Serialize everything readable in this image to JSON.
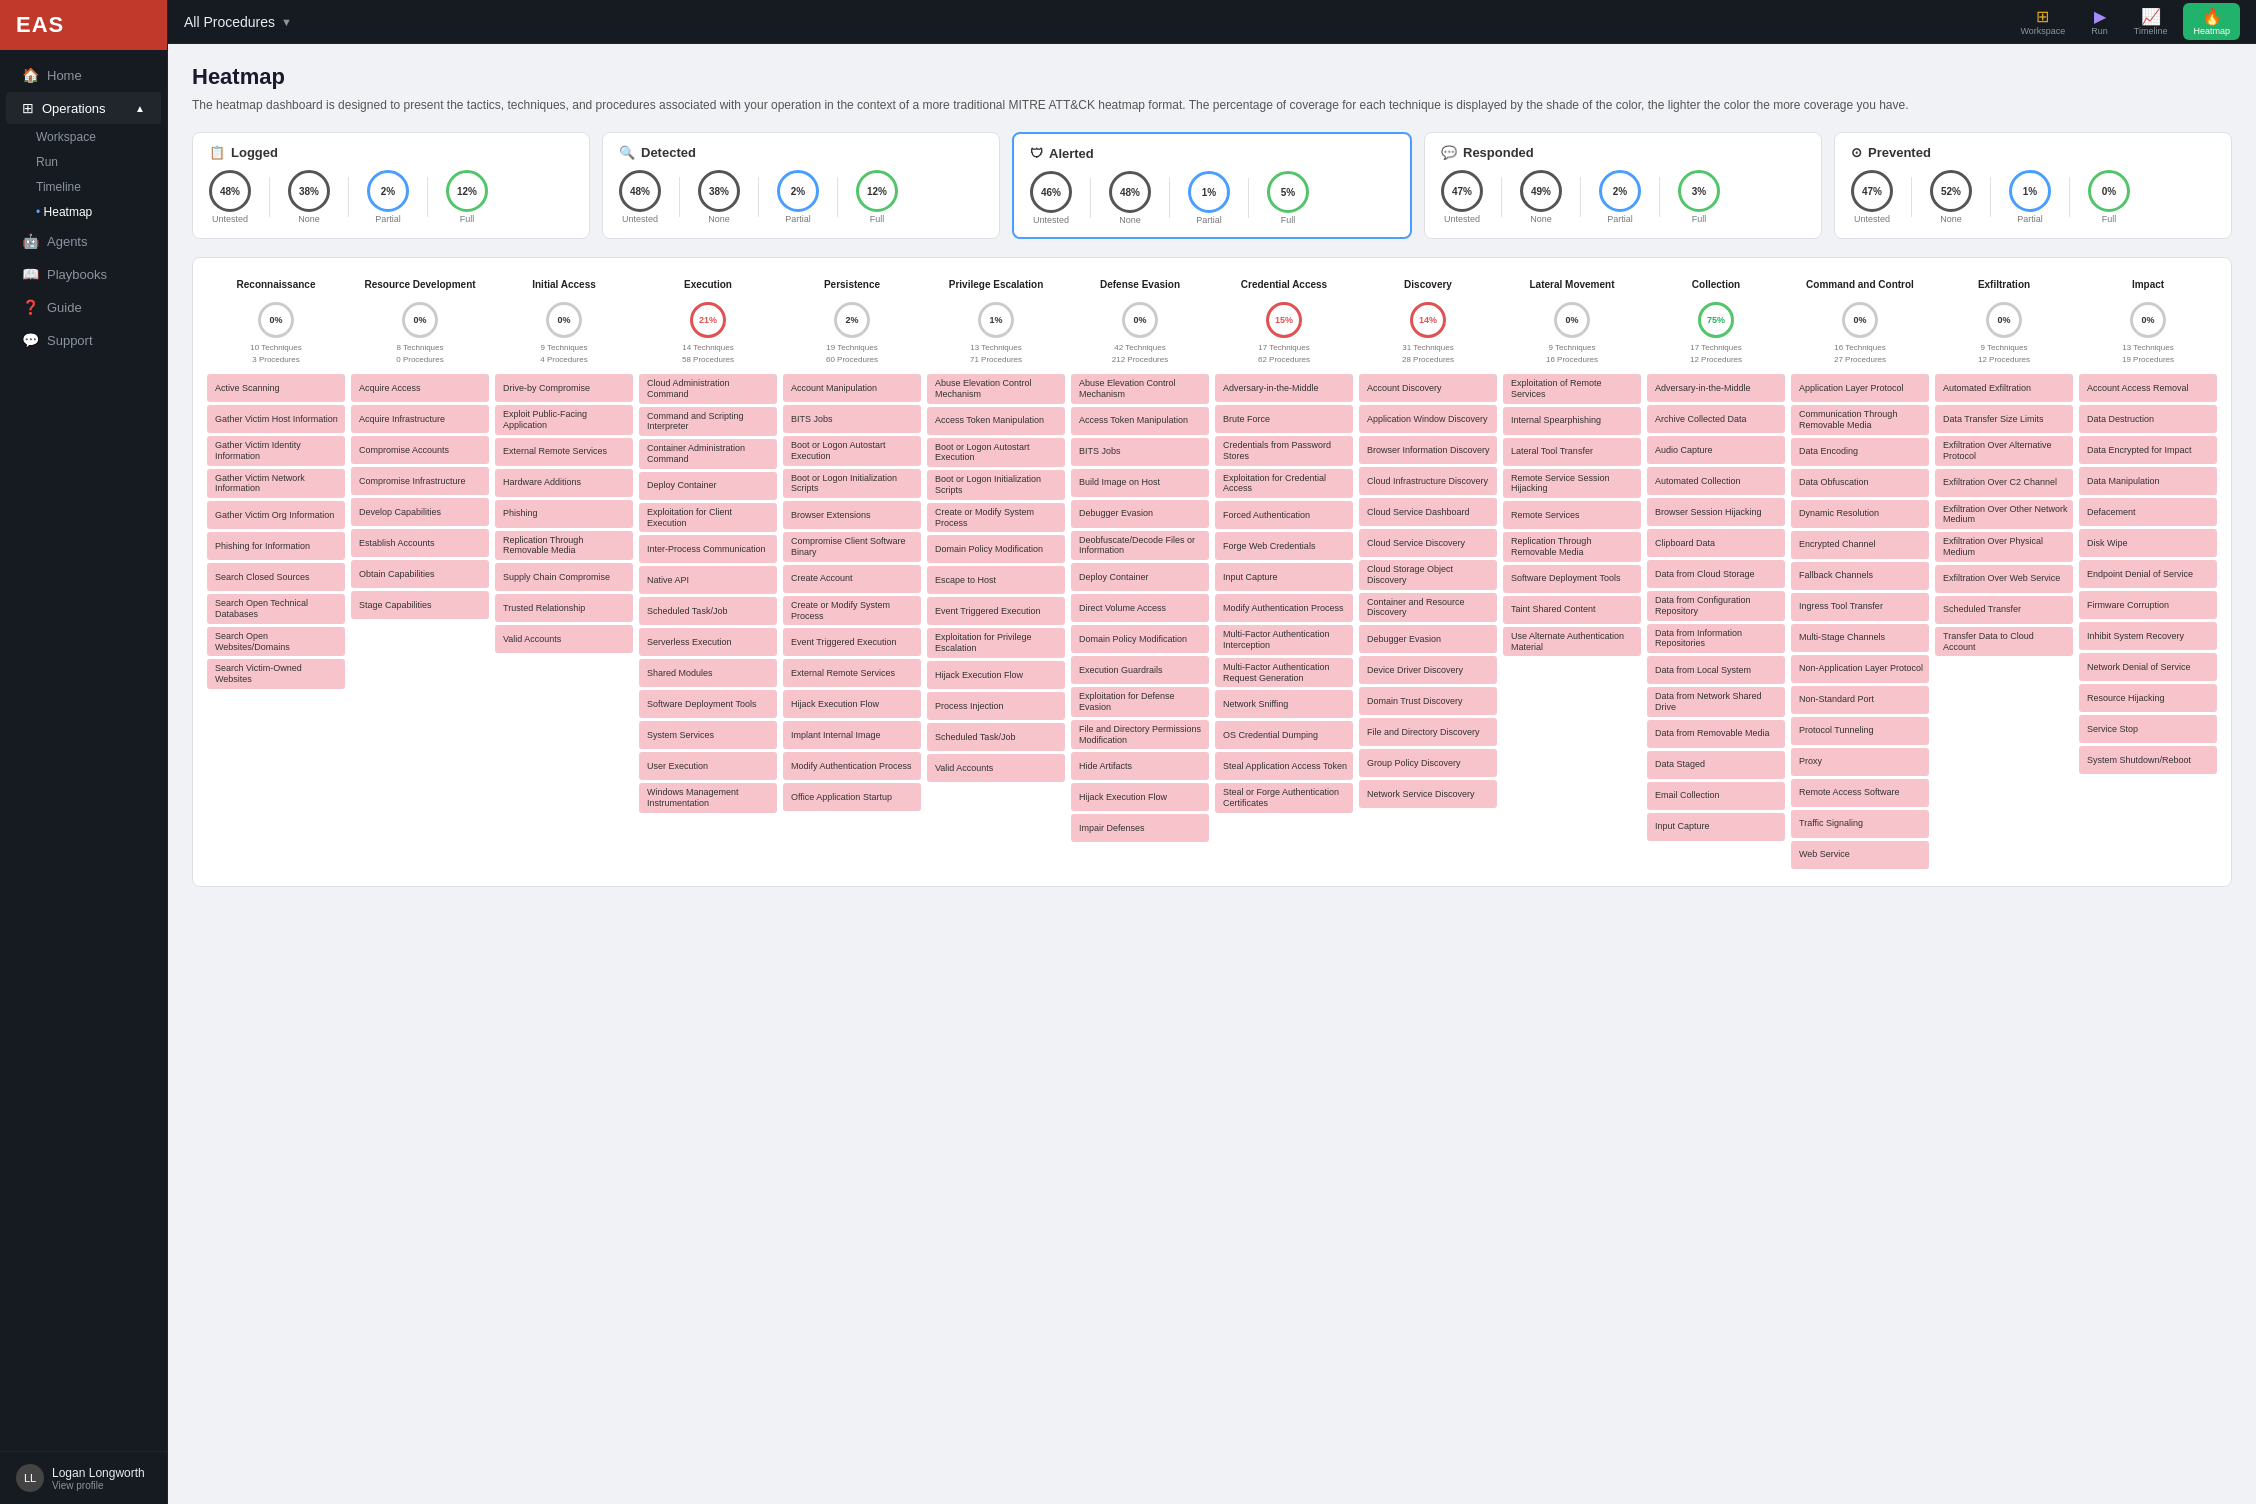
{
  "app": {
    "logo": "EAS",
    "procedure_selector": "All Procedures",
    "topbar_buttons": [
      {
        "id": "workspace",
        "label": "Workspace",
        "icon": "⊞"
      },
      {
        "id": "run",
        "label": "Run",
        "icon": "▶"
      },
      {
        "id": "timeline",
        "label": "Timeline",
        "icon": "📈"
      },
      {
        "id": "heatmap",
        "label": "Heatmap",
        "icon": "🔥",
        "active": true
      }
    ]
  },
  "sidebar": {
    "nav_items": [
      {
        "id": "home",
        "label": "Home",
        "icon": "🏠"
      },
      {
        "id": "operations",
        "label": "Operations",
        "icon": "⚙",
        "active": true,
        "expanded": true
      },
      {
        "id": "agents",
        "label": "Agents",
        "icon": "🤖"
      },
      {
        "id": "playbooks",
        "label": "Playbooks",
        "icon": "📖"
      },
      {
        "id": "guide",
        "label": "Guide",
        "icon": "❓"
      },
      {
        "id": "support",
        "label": "Support",
        "icon": "💬"
      }
    ],
    "sub_items": [
      {
        "id": "workspace",
        "label": "Workspace"
      },
      {
        "id": "run",
        "label": "Run"
      },
      {
        "id": "timeline",
        "label": "Timeline"
      },
      {
        "id": "heatmap",
        "label": "Heatmap",
        "active": true
      }
    ],
    "user": {
      "name": "Logan Longworth",
      "sub": "View profile"
    }
  },
  "page": {
    "title": "Heatmap",
    "description": "The heatmap dashboard is designed to present the tactics, techniques, and procedures associated with your operation in the context of a more traditional MITRE ATT&CK heatmap format. The percentage of coverage for each technique is displayed by the shade of the color, the lighter the color the more coverage you have."
  },
  "summary_cards": [
    {
      "id": "logged",
      "title": "Logged",
      "icon": "📋",
      "metrics": [
        {
          "label": "Untested",
          "value": "48%",
          "ring": "dark"
        },
        {
          "label": "None",
          "value": "38%",
          "ring": "dark"
        },
        {
          "label": "Partial",
          "value": "2%",
          "ring": "blue"
        },
        {
          "label": "Full",
          "value": "12%",
          "ring": "green"
        }
      ]
    },
    {
      "id": "detected",
      "title": "Detected",
      "icon": "🔍",
      "metrics": [
        {
          "label": "Untested",
          "value": "48%",
          "ring": "dark"
        },
        {
          "label": "None",
          "value": "38%",
          "ring": "dark"
        },
        {
          "label": "Partial",
          "value": "2%",
          "ring": "blue"
        },
        {
          "label": "Full",
          "value": "12%",
          "ring": "green"
        }
      ]
    },
    {
      "id": "alerted",
      "title": "Alerted",
      "icon": "🛡",
      "highlighted": true,
      "metrics": [
        {
          "label": "Untested",
          "value": "46%",
          "ring": "dark"
        },
        {
          "label": "None",
          "value": "48%",
          "ring": "dark"
        },
        {
          "label": "Partial",
          "value": "1%",
          "ring": "blue"
        },
        {
          "label": "Full",
          "value": "5%",
          "ring": "green"
        }
      ]
    },
    {
      "id": "responded",
      "title": "Responded",
      "icon": "💬",
      "metrics": [
        {
          "label": "Untested",
          "value": "47%",
          "ring": "dark"
        },
        {
          "label": "None",
          "value": "49%",
          "ring": "dark"
        },
        {
          "label": "Partial",
          "value": "2%",
          "ring": "blue"
        },
        {
          "label": "Full",
          "value": "3%",
          "ring": "green"
        }
      ]
    },
    {
      "id": "prevented",
      "title": "Prevented",
      "icon": "⊙",
      "metrics": [
        {
          "label": "Untested",
          "value": "47%",
          "ring": "dark"
        },
        {
          "label": "None",
          "value": "52%",
          "ring": "dark"
        },
        {
          "label": "Partial",
          "value": "1%",
          "ring": "blue"
        },
        {
          "label": "Full",
          "value": "0%",
          "ring": "green"
        }
      ]
    }
  ],
  "heatmap_columns": [
    {
      "id": "reconnaissance",
      "title": "Reconnaissance",
      "percent": "0%",
      "ring": "normal",
      "techniques": 10,
      "procedures": 3,
      "cells": [
        "Active Scanning",
        "Gather Victim Host Information",
        "Gather Victim Identity Information",
        "Gather Victim Network Information",
        "Gather Victim Org Information",
        "Phishing for Information",
        "Search Closed Sources",
        "Search Open Technical Databases",
        "Search Open Websites/Domains",
        "Search Victim-Owned Websites"
      ]
    },
    {
      "id": "resource-development",
      "title": "Resource Development",
      "percent": "0%",
      "ring": "normal",
      "techniques": 8,
      "procedures": 0,
      "cells": [
        "Acquire Access",
        "Acquire Infrastructure",
        "Compromise Accounts",
        "Compromise Infrastructure",
        "Develop Capabilities",
        "Establish Accounts",
        "Obtain Capabilities",
        "Stage Capabilities"
      ]
    },
    {
      "id": "initial-access",
      "title": "Initial Access",
      "percent": "0%",
      "ring": "normal",
      "techniques": 9,
      "procedures": 4,
      "cells": [
        "Drive-by Compromise",
        "Exploit Public-Facing Application",
        "External Remote Services",
        "Hardware Additions",
        "Phishing",
        "Replication Through Removable Media",
        "Supply Chain Compromise",
        "Trusted Relationship",
        "Valid Accounts"
      ]
    },
    {
      "id": "execution",
      "title": "Execution",
      "percent": "21%",
      "ring": "red",
      "techniques": 14,
      "procedures": 58,
      "cells": [
        "Cloud Administration Command",
        "Command and Scripting Interpreter",
        "Container Administration Command",
        "Deploy Container",
        "Exploitation for Client Execution",
        "Inter-Process Communication",
        "Native API",
        "Scheduled Task/Job",
        "Serverless Execution",
        "Shared Modules",
        "Software Deployment Tools",
        "System Services",
        "User Execution",
        "Windows Management Instrumentation"
      ]
    },
    {
      "id": "persistence",
      "title": "Persistence",
      "percent": "2%",
      "ring": "normal",
      "techniques": 19,
      "procedures": 60,
      "cells": [
        "Account Manipulation",
        "BITS Jobs",
        "Boot or Logon Autostart Execution",
        "Boot or Logon Initialization Scripts",
        "Browser Extensions",
        "Compromise Client Software Binary",
        "Create Account",
        "Create or Modify System Process",
        "Event Triggered Execution",
        "External Remote Services",
        "Hijack Execution Flow",
        "Implant Internal Image",
        "Modify Authentication Process",
        "Office Application Startup"
      ]
    },
    {
      "id": "privilege-escalation",
      "title": "Privilege Escalation",
      "percent": "1%",
      "ring": "normal",
      "techniques": 13,
      "procedures": 71,
      "cells": [
        "Abuse Elevation Control Mechanism",
        "Access Token Manipulation",
        "Boot or Logon Autostart Execution",
        "Boot or Logon Initialization Scripts",
        "Create or Modify System Process",
        "Domain Policy Modification",
        "Escape to Host",
        "Event Triggered Execution",
        "Exploitation for Privilege Escalation",
        "Hijack Execution Flow",
        "Process Injection",
        "Scheduled Task/Job",
        "Valid Accounts"
      ]
    },
    {
      "id": "defense-evasion",
      "title": "Defense Evasion",
      "percent": "0%",
      "ring": "normal",
      "techniques": 42,
      "procedures": 212,
      "cells": [
        "Abuse Elevation Control Mechanism",
        "Access Token Manipulation",
        "BITS Jobs",
        "Build Image on Host",
        "Debugger Evasion",
        "Deobfuscate/Decode Files or Information",
        "Deploy Container",
        "Direct Volume Access",
        "Domain Policy Modification",
        "Execution Guardrails",
        "Exploitation for Defense Evasion",
        "File and Directory Permissions Modification",
        "Hide Artifacts",
        "Hijack Execution Flow",
        "Impair Defenses"
      ]
    },
    {
      "id": "credential-access",
      "title": "Credential Access",
      "percent": "15%",
      "ring": "red",
      "techniques": 17,
      "procedures": 62,
      "cells": [
        "Adversary-in-the-Middle",
        "Brute Force",
        "Credentials from Password Stores",
        "Exploitation for Credential Access",
        "Forced Authentication",
        "Forge Web Credentials",
        "Input Capture",
        "Modify Authentication Process",
        "Multi-Factor Authentication Interception",
        "Multi-Factor Authentication Request Generation",
        "Network Sniffing",
        "OS Credential Dumping",
        "Steal Application Access Token",
        "Steal or Forge Authentication Certificates"
      ]
    },
    {
      "id": "discovery",
      "title": "Discovery",
      "percent": "14%",
      "ring": "red",
      "techniques": 31,
      "procedures": 28,
      "cells": [
        "Account Discovery",
        "Application Window Discovery",
        "Browser Information Discovery",
        "Cloud Infrastructure Discovery",
        "Cloud Service Dashboard",
        "Cloud Service Discovery",
        "Cloud Storage Object Discovery",
        "Container and Resource Discovery",
        "Debugger Evasion",
        "Device Driver Discovery",
        "Domain Trust Discovery",
        "File and Directory Discovery",
        "Group Policy Discovery",
        "Network Service Discovery"
      ]
    },
    {
      "id": "lateral-movement",
      "title": "Lateral Movement",
      "percent": "0%",
      "ring": "normal",
      "techniques": 9,
      "procedures": 16,
      "cells": [
        "Exploitation of Remote Services",
        "Internal Spearphishing",
        "Lateral Tool Transfer",
        "Remote Service Session Hijacking",
        "Remote Services",
        "Replication Through Removable Media",
        "Software Deployment Tools",
        "Taint Shared Content",
        "Use Alternate Authentication Material"
      ]
    },
    {
      "id": "collection",
      "title": "Collection",
      "percent": "75%",
      "ring": "green",
      "techniques": 17,
      "procedures": 12,
      "cells": [
        "Adversary-in-the-Middle",
        "Archive Collected Data",
        "Audio Capture",
        "Automated Collection",
        "Browser Session Hijacking",
        "Clipboard Data",
        "Data from Cloud Storage",
        "Data from Configuration Repository",
        "Data from Information Repositories",
        "Data from Local System",
        "Data from Network Shared Drive",
        "Data from Removable Media",
        "Data Staged",
        "Email Collection",
        "Input Capture"
      ]
    },
    {
      "id": "command-control",
      "title": "Command and Control",
      "percent": "0%",
      "ring": "normal",
      "techniques": 16,
      "procedures": 27,
      "cells": [
        "Application Layer Protocol",
        "Communication Through Removable Media",
        "Data Encoding",
        "Data Obfuscation",
        "Dynamic Resolution",
        "Encrypted Channel",
        "Fallback Channels",
        "Ingress Tool Transfer",
        "Multi-Stage Channels",
        "Non-Application Layer Protocol",
        "Non-Standard Port",
        "Protocol Tunneling",
        "Proxy",
        "Remote Access Software",
        "Traffic Signaling",
        "Web Service"
      ]
    },
    {
      "id": "exfiltration",
      "title": "Exfiltration",
      "percent": "0%",
      "ring": "normal",
      "techniques": 9,
      "procedures": 12,
      "cells": [
        "Automated Exfiltration",
        "Data Transfer Size Limits",
        "Exfiltration Over Alternative Protocol",
        "Exfiltration Over C2 Channel",
        "Exfiltration Over Other Network Medium",
        "Exfiltration Over Physical Medium",
        "Exfiltration Over Web Service",
        "Scheduled Transfer",
        "Transfer Data to Cloud Account"
      ]
    },
    {
      "id": "impact",
      "title": "Impact",
      "percent": "0%",
      "ring": "normal",
      "techniques": 13,
      "procedures": 19,
      "cells": [
        "Account Access Removal",
        "Data Destruction",
        "Data Encrypted for Impact",
        "Data Manipulation",
        "Defacement",
        "Disk Wipe",
        "Endpoint Denial of Service",
        "Firmware Corruption",
        "Inhibit System Recovery",
        "Network Denial of Service",
        "Resource Hijacking",
        "Service Stop",
        "System Shutdown/Reboot"
      ]
    }
  ]
}
